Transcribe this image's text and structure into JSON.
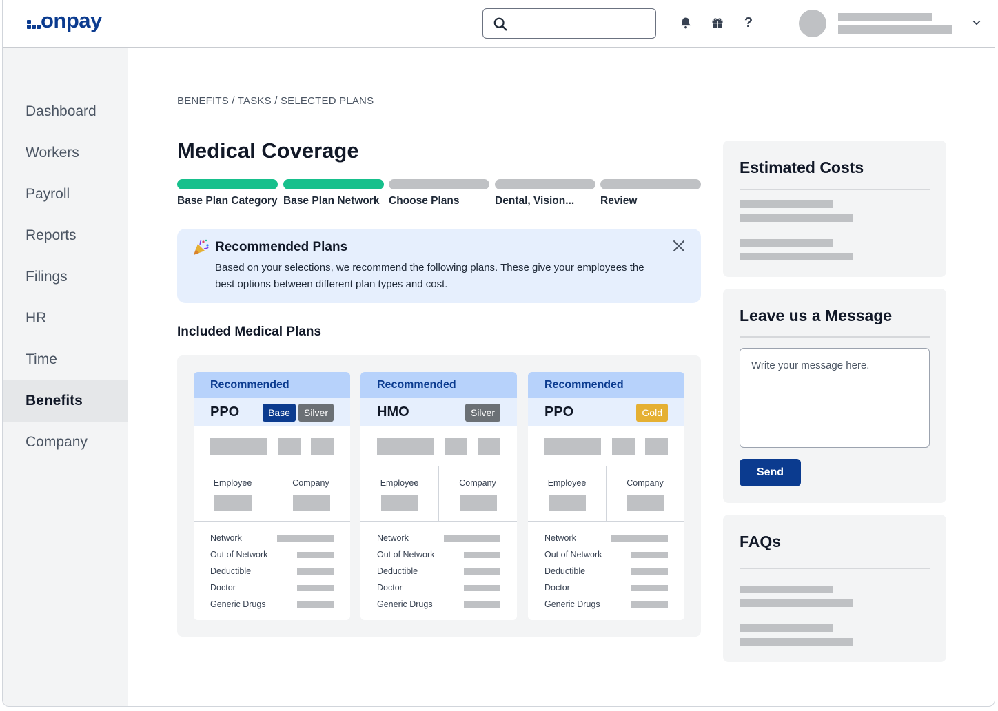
{
  "brand": {
    "logo_text": "onpay",
    "primary_color": "#0b3b8f",
    "accent_green": "#17c08c"
  },
  "header": {
    "search": {
      "placeholder": "",
      "value": ""
    },
    "icons": [
      "bell-icon",
      "gift-icon",
      "help-icon"
    ],
    "help_glyph": "?"
  },
  "sidebar": {
    "items": [
      {
        "label": "Dashboard",
        "active": false
      },
      {
        "label": "Workers",
        "active": false
      },
      {
        "label": "Payroll",
        "active": false
      },
      {
        "label": "Reports",
        "active": false
      },
      {
        "label": "Filings",
        "active": false
      },
      {
        "label": "HR",
        "active": false
      },
      {
        "label": "Time",
        "active": false
      },
      {
        "label": "Benefits",
        "active": true
      },
      {
        "label": "Company",
        "active": false
      }
    ]
  },
  "main": {
    "breadcrumb": "BENEFITS / TASKS / SELECTED PLANS",
    "title": "Medical Coverage",
    "steps": [
      {
        "label": "Base Plan Category",
        "complete": true
      },
      {
        "label": "Base Plan Network",
        "complete": true
      },
      {
        "label": "Choose Plans",
        "complete": false
      },
      {
        "label": "Dental, Vision...",
        "complete": false
      },
      {
        "label": "Review",
        "complete": false
      }
    ],
    "banner": {
      "icon": "party-popper-icon",
      "title": "Recommended Plans",
      "text": "Based on your selections, we recommend the following plans. These give your employees the best options between different plan types and cost."
    },
    "plans_section_title": "Included Medical Plans",
    "plans": [
      {
        "recommended_label": "Recommended",
        "name": "PPO",
        "tags": [
          {
            "label": "Base",
            "kind": "base"
          },
          {
            "label": "Silver",
            "kind": "silver"
          }
        ],
        "split": [
          "Employee",
          "Company"
        ],
        "details": [
          "Network",
          "Out of Network",
          "Deductible",
          "Doctor",
          "Generic Drugs"
        ]
      },
      {
        "recommended_label": "Recommended",
        "name": "HMO",
        "tags": [
          {
            "label": "Silver",
            "kind": "silver"
          }
        ],
        "split": [
          "Employee",
          "Company"
        ],
        "details": [
          "Network",
          "Out of Network",
          "Deductible",
          "Doctor",
          "Generic Drugs"
        ]
      },
      {
        "recommended_label": "Recommended",
        "name": "PPO",
        "tags": [
          {
            "label": "Gold",
            "kind": "gold"
          }
        ],
        "split": [
          "Employee",
          "Company"
        ],
        "details": [
          "Network",
          "Out of Network",
          "Deductible",
          "Doctor",
          "Generic Drugs"
        ]
      }
    ]
  },
  "right": {
    "estimated_costs": {
      "title": "Estimated Costs"
    },
    "message": {
      "title": "Leave us a Message",
      "placeholder": "Write your message here.",
      "value": "",
      "send_label": "Send"
    },
    "faqs": {
      "title": "FAQs"
    }
  }
}
